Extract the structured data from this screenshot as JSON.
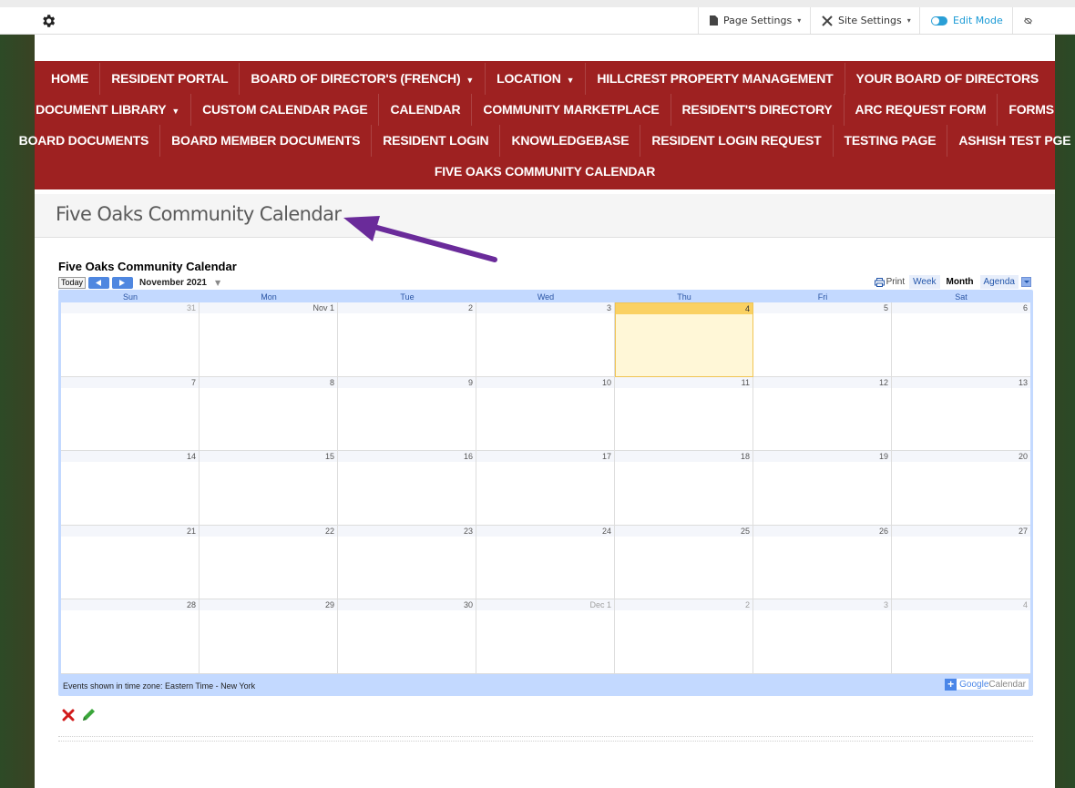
{
  "admin_bar": {
    "page_settings": "Page Settings",
    "site_settings": "Site Settings",
    "edit_mode": "Edit Mode"
  },
  "nav": {
    "rows": [
      [
        {
          "label": "HOME",
          "dropdown": false
        },
        {
          "label": "RESIDENT PORTAL",
          "dropdown": false
        },
        {
          "label": "BOARD OF DIRECTOR'S (FRENCH)",
          "dropdown": true
        },
        {
          "label": "LOCATION",
          "dropdown": true
        },
        {
          "label": "HILLCREST PROPERTY MANAGEMENT",
          "dropdown": false
        },
        {
          "label": "YOUR BOARD OF DIRECTORS",
          "dropdown": false
        }
      ],
      [
        {
          "label": "DOCUMENT LIBRARY",
          "dropdown": true
        },
        {
          "label": "CUSTOM CALENDAR PAGE",
          "dropdown": false
        },
        {
          "label": "CALENDAR",
          "dropdown": false
        },
        {
          "label": "COMMUNITY MARKETPLACE",
          "dropdown": false
        },
        {
          "label": "RESIDENT'S DIRECTORY",
          "dropdown": false
        },
        {
          "label": "ARC REQUEST FORM",
          "dropdown": false
        },
        {
          "label": "FORMS",
          "dropdown": false
        }
      ],
      [
        {
          "label": "BOARD DOCUMENTS",
          "dropdown": false
        },
        {
          "label": "BOARD MEMBER DOCUMENTS",
          "dropdown": false
        },
        {
          "label": "RESIDENT LOGIN",
          "dropdown": false
        },
        {
          "label": "KNOWLEDGEBASE",
          "dropdown": false
        },
        {
          "label": "RESIDENT LOGIN REQUEST",
          "dropdown": false
        },
        {
          "label": "TESTING PAGE",
          "dropdown": false
        },
        {
          "label": "ASHISH TEST PGE",
          "dropdown": false
        }
      ],
      [
        {
          "label": "FIVE OAKS COMMUNITY CALENDAR",
          "dropdown": false
        }
      ]
    ]
  },
  "page_title": "Five Oaks Community Calendar",
  "calendar": {
    "title": "Five Oaks Community Calendar",
    "today_label": "Today",
    "month_label": "November 2021",
    "print_label": "Print",
    "views": [
      "Week",
      "Month",
      "Agenda"
    ],
    "active_view": "Month",
    "weekdays": [
      "Sun",
      "Mon",
      "Tue",
      "Wed",
      "Thu",
      "Fri",
      "Sat"
    ],
    "weeks": [
      [
        "31",
        "Nov 1",
        "2",
        "3",
        "4",
        "5",
        "6"
      ],
      [
        "7",
        "8",
        "9",
        "10",
        "11",
        "12",
        "13"
      ],
      [
        "14",
        "15",
        "16",
        "17",
        "18",
        "19",
        "20"
      ],
      [
        "21",
        "22",
        "23",
        "24",
        "25",
        "26",
        "27"
      ],
      [
        "28",
        "29",
        "30",
        "Dec 1",
        "2",
        "3",
        "4"
      ]
    ],
    "other_month_cells": [
      "0-0",
      "4-3",
      "4-4",
      "4-5",
      "4-6"
    ],
    "today_cell": "0-4",
    "timezone_note": "Events shown in time zone: Eastern Time - New York",
    "badge_google": "Google",
    "badge_calendar": "Calendar"
  },
  "colors": {
    "nav_bg": "#9e2121",
    "calendar_frame": "#c3d9ff",
    "today_bg": "#fff7d7",
    "accent_blue": "#1a9ad6"
  }
}
